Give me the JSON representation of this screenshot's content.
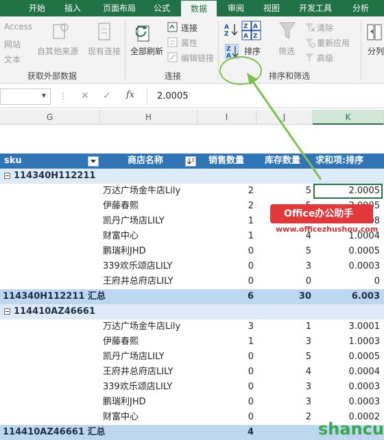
{
  "ribbon": {
    "tabs": [
      "开始",
      "插入",
      "页面布局",
      "公式",
      "数据",
      "审阅",
      "视图",
      "开发工具",
      "分析"
    ],
    "active_tab": "数据",
    "external_data": {
      "access": "Access",
      "web": "网站",
      "text": "文本",
      "other_sources": "自其他来源",
      "existing_connections": "现有连接",
      "group_label": "获取外部数据"
    },
    "connections": {
      "refresh_all": "全部刷新",
      "connections": "连接",
      "properties": "属性",
      "edit_links": "编辑链接",
      "group_label": "连接"
    },
    "sort_filter": {
      "sort": "排序",
      "filter": "筛选",
      "clear": "清除",
      "reapply": "重新应用",
      "advanced": "高级",
      "group_label": "排序和筛选"
    },
    "split": "分列"
  },
  "formula_bar": {
    "cancel": "✕",
    "enter": "✓",
    "fx": "fx",
    "value": "2.0005"
  },
  "columns": [
    "G",
    "H",
    "I",
    "J",
    "K"
  ],
  "pivot": {
    "headers": {
      "sku": "sku",
      "store": "商店名称",
      "sales": "销售数量",
      "stock": "库存数量",
      "sum": "求和项:排序"
    },
    "groups": [
      {
        "sku": "114340H112211",
        "rows": [
          {
            "store": "万达广场金牛店Lily",
            "sales": "2",
            "stock": "5",
            "sum": "2.0005"
          },
          {
            "store": "伊藤春熙",
            "sales": "2",
            "stock": "5",
            "sum": "2.0005"
          },
          {
            "store": "凯丹广场店LILY",
            "sales": "1",
            "stock": "8",
            "sum": "1.0008"
          },
          {
            "store": "财富中心",
            "sales": "1",
            "stock": "4",
            "sum": "1.0004"
          },
          {
            "store": "鹏瑞利JHD",
            "sales": "0",
            "stock": "5",
            "sum": "0.0005"
          },
          {
            "store": "339欢乐颂店LILY",
            "sales": "0",
            "stock": "3",
            "sum": "0.0003"
          },
          {
            "store": "王府井总府店LILY",
            "sales": "0",
            "stock": "0",
            "sum": "0"
          }
        ],
        "total_label": "114340H112211 汇总",
        "total_sales": "6",
        "total_stock": "30",
        "total_sum": "6.003"
      },
      {
        "sku": "114410AZ46661",
        "rows": [
          {
            "store": "万达广场金牛店Lily",
            "sales": "3",
            "stock": "1",
            "sum": "3.0001"
          },
          {
            "store": "伊藤春熙",
            "sales": "1",
            "stock": "3",
            "sum": "1.0003"
          },
          {
            "store": "凯丹广场店LILY",
            "sales": "0",
            "stock": "5",
            "sum": "0.0005"
          },
          {
            "store": "王府井总府店LILY",
            "sales": "0",
            "stock": "4",
            "sum": "0.0004"
          },
          {
            "store": "339欢乐颂店LILY",
            "sales": "0",
            "stock": "3",
            "sum": "0.0003"
          },
          {
            "store": "鹏瑞利JHD",
            "sales": "0",
            "stock": "3",
            "sum": "0.0003"
          },
          {
            "store": "财富中心",
            "sales": "0",
            "stock": "2",
            "sum": "0.0002"
          }
        ],
        "total_label": "114410AZ46661 汇总",
        "total_sales": "4"
      }
    ]
  },
  "watermarks": {
    "office": "Office办公助手",
    "url": "www.officezhushou.com",
    "shancun": "shancun"
  },
  "colors": {
    "excel_green": "#217346",
    "pivot_header": "#2f75b5",
    "pivot_total": "#bdd7ee",
    "highlight": "#7fbf4d"
  }
}
